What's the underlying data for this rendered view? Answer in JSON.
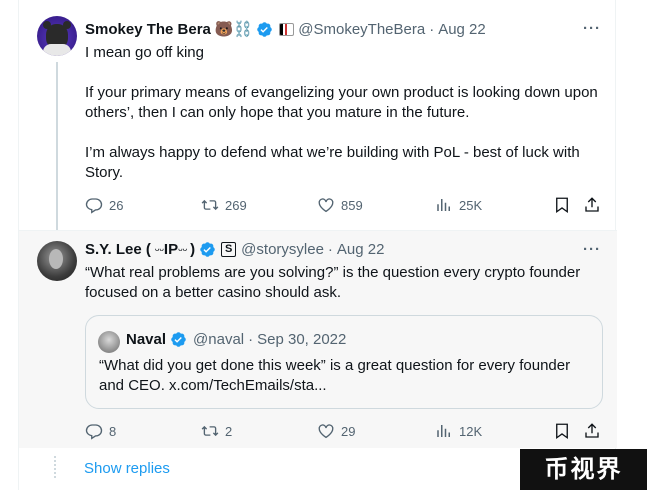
{
  "tweet1": {
    "name": "Smokey The Bera",
    "emoji": "🐻⛓️",
    "handle": "@SmokeyTheBera",
    "date": "Aug 22",
    "more": "···",
    "paragraphs": [
      "I mean go off king",
      "If your primary means of evangelizing your own product is looking down upon others’, then I can only hope that you mature in the future.",
      "I’m always happy to defend what we’re building with PoL - best of luck with Story."
    ],
    "replies": "26",
    "reposts": "269",
    "likes": "859",
    "views": "25K"
  },
  "tweet2": {
    "name": "S.Y. Lee (",
    "name_ip": "IP",
    "name_close": ")",
    "handle": "@storysylee",
    "date": "Aug 22",
    "more": "···",
    "text": "“What real problems are you solving?” is the question every crypto founder focused on a better casino should ask.",
    "replies": "8",
    "reposts": "2",
    "likes": "29",
    "views": "12K",
    "quote": {
      "name": "Naval",
      "handle": "@naval",
      "date": "Sep 30, 2022",
      "text": "“What did you get done this week” is a great question for every founder and CEO. x.com/TechEmails/sta..."
    }
  },
  "show_replies": "Show replies",
  "watermark": "币视界",
  "colors": {
    "accent": "#1d9bf0",
    "muted": "#536471",
    "text": "#0f1419"
  },
  "icons": [
    "more-icon",
    "verified-icon",
    "reply-icon",
    "repost-icon",
    "like-icon",
    "views-icon",
    "bookmark-icon",
    "share-icon"
  ]
}
